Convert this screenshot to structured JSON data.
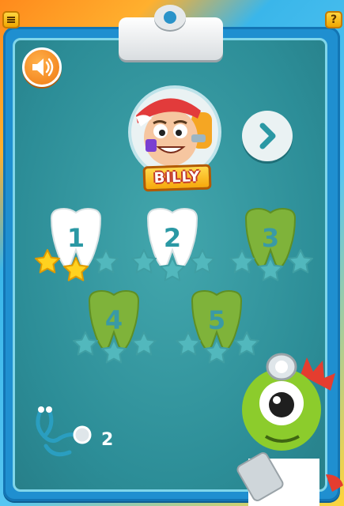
{
  "header": {
    "menu_icon": "menu-icon",
    "help_label": "?"
  },
  "sound": {
    "icon": "speaker-icon"
  },
  "patient": {
    "name": "BILLY"
  },
  "navigation": {
    "next_icon": "chevron-right-icon"
  },
  "levels": [
    {
      "label": "1",
      "stars": 2,
      "max_stars": 3,
      "locked": false
    },
    {
      "label": "2",
      "stars": 0,
      "max_stars": 3,
      "locked": false
    },
    {
      "label": "3",
      "stars": 0,
      "max_stars": 3,
      "locked": true
    },
    {
      "label": "4",
      "stars": 0,
      "max_stars": 3,
      "locked": true
    },
    {
      "label": "5",
      "stars": 0,
      "max_stars": 3,
      "locked": true
    }
  ],
  "tools": {
    "icon": "stethoscope-icon",
    "count": "2"
  },
  "colors": {
    "board": "#1f8fd0",
    "panel": "#2c8d97",
    "star_earned": "#ffd21f",
    "star_empty": "#52b8bd",
    "tooth_unlocked": "#ffffff",
    "tooth_locked": "#7fb33a"
  }
}
